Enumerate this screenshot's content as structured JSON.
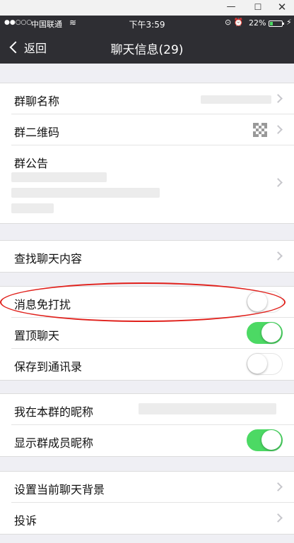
{
  "window": {
    "minimize": "—",
    "maximize": "☐",
    "close": "✕"
  },
  "status_bar": {
    "signal": "●●○○○",
    "carrier": "中国联通",
    "wifi": "≋",
    "time": "下午3:59",
    "icons": "⊙ ⏰",
    "battery_pct": "22%",
    "battery_level": 0.22,
    "battery_color": "#4cd964",
    "charging": "⚡"
  },
  "nav": {
    "back_label": "返回",
    "title": "聊天信息(29)"
  },
  "groups": {
    "info": {
      "group_name": "群聊名称",
      "qr_code": "群二维码",
      "announcement": "群公告"
    },
    "search": {
      "search_history": "查找聊天内容"
    },
    "settings": {
      "mute": {
        "label": "消息免打扰",
        "on": false
      },
      "pin": {
        "label": "置顶聊天",
        "on": true
      },
      "save_contacts": {
        "label": "保存到通讯录",
        "on": false
      }
    },
    "nickname": {
      "my_nickname": "我在本群的昵称",
      "show_nicknames": {
        "label": "显示群成员昵称",
        "on": true
      }
    },
    "more": {
      "background": "设置当前聊天背景",
      "report": "投诉"
    }
  },
  "colors": {
    "toggle_on": "#4cd964",
    "nav_bg": "#2e2e33",
    "annotation": "#e0201b"
  }
}
